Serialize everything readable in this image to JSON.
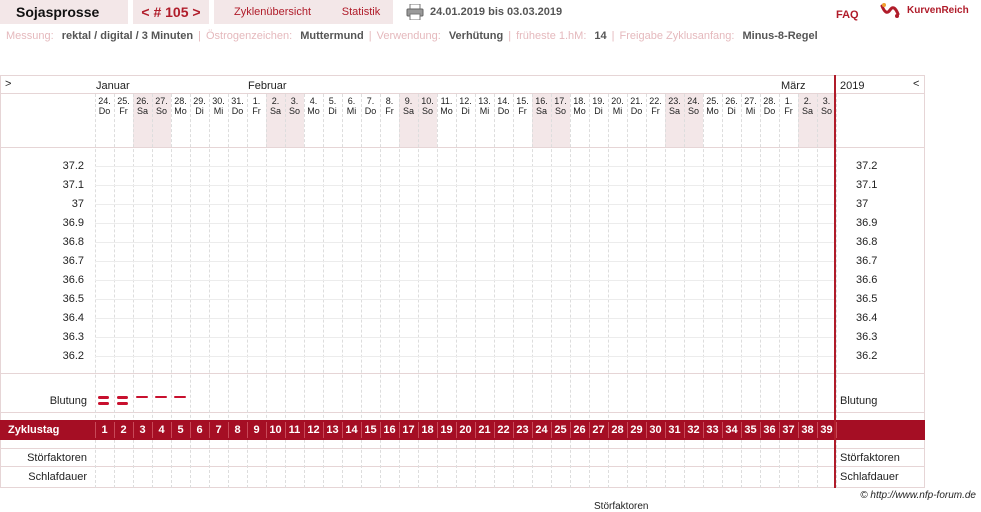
{
  "topbar": {
    "user": "Sojasprosse",
    "cycle": "< # 105 >",
    "overview": "Zyklenübersicht",
    "stats": "Statistik",
    "daterange": "24.01.2019 bis 03.03.2019",
    "faq": "FAQ",
    "logo": "KurvenReich"
  },
  "info": {
    "messung_label": "Messung:",
    "messung_value": "rektal / digital / 3 Minuten",
    "oestro_label": "Östrogenzeichen:",
    "oestro_value": "Muttermund",
    "verwendung_label": "Verwendung:",
    "verwendung_value": "Verhütung",
    "hm_label": "früheste 1.hM:",
    "hm_value": "14",
    "freigabe_label": "Freigabe Zyklusanfang:",
    "freigabe_value": "Minus-8-Regel"
  },
  "chart": {
    "nav_left": ">",
    "nav_right": "<",
    "year": "2019",
    "months": [
      "Januar",
      "Februar",
      "März"
    ],
    "dates": [
      "24.",
      "25.",
      "26.",
      "27.",
      "28.",
      "29.",
      "30.",
      "31.",
      "1.",
      "2.",
      "3.",
      "4.",
      "5.",
      "6.",
      "7.",
      "8.",
      "9.",
      "10.",
      "11.",
      "12.",
      "13.",
      "14.",
      "15.",
      "16.",
      "17.",
      "18.",
      "19.",
      "20.",
      "21.",
      "22.",
      "23.",
      "24.",
      "25.",
      "26.",
      "27.",
      "28.",
      "1.",
      "2.",
      "3."
    ],
    "weekdays": [
      "Do",
      "Fr",
      "Sa",
      "So",
      "Mo",
      "Di",
      "Mi",
      "Do",
      "Fr",
      "Sa",
      "So",
      "Mo",
      "Di",
      "Mi",
      "Do",
      "Fr",
      "Sa",
      "So",
      "Mo",
      "Di",
      "Mi",
      "Do",
      "Fr",
      "Sa",
      "So",
      "Mo",
      "Di",
      "Mi",
      "Do",
      "Fr",
      "Sa",
      "So",
      "Mo",
      "Di",
      "Mi",
      "Do",
      "Fr",
      "Sa",
      "So"
    ],
    "temps": [
      "37.2",
      "37.1",
      "37",
      "36.9",
      "36.8",
      "36.7",
      "36.6",
      "36.5",
      "36.4",
      "36.3",
      "36.2"
    ],
    "bleeding_label": "Blutung",
    "bleeding": [
      "heavy",
      "heavy",
      "light",
      "light",
      "light"
    ],
    "cycle_label": "Zyklustag",
    "cycle_days": [
      "1",
      "2",
      "3",
      "4",
      "5",
      "6",
      "7",
      "8",
      "9",
      "10",
      "11",
      "12",
      "13",
      "14",
      "15",
      "16",
      "17",
      "18",
      "19",
      "20",
      "21",
      "22",
      "23",
      "24",
      "25",
      "26",
      "27",
      "28",
      "29",
      "30",
      "31",
      "32",
      "33",
      "34",
      "35",
      "36",
      "37",
      "38",
      "39"
    ],
    "stoer_label": "Störfaktoren",
    "schlaf_label": "Schlafdauer"
  },
  "footer": {
    "copyright": "© http://www.nfp-forum.de",
    "cut_text": "Störfaktoren"
  },
  "colors": {
    "accent": "#b01c2a",
    "cycle_bar": "#a50e24",
    "weekend_bg": "#f3e7e8"
  }
}
